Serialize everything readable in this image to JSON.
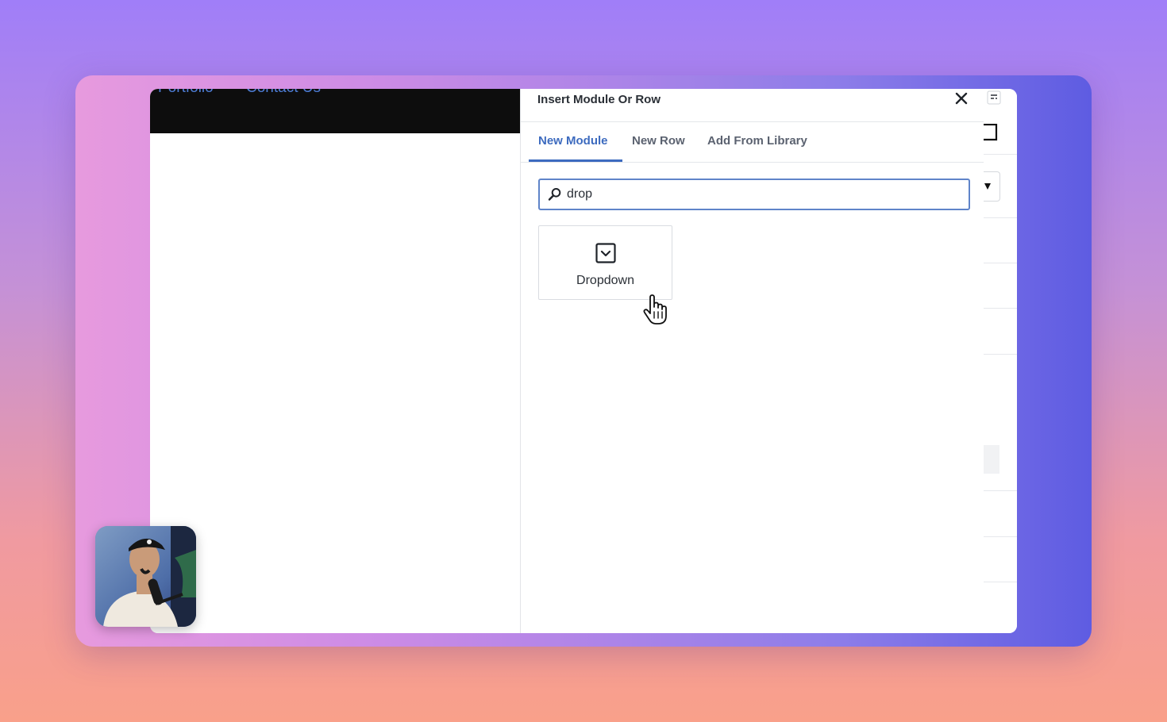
{
  "site": {
    "nav": [
      "Portfolio",
      "Contact Us"
    ]
  },
  "panel": {
    "title": "Insert Module Or Row",
    "close_icon": "close-icon",
    "tabs": [
      {
        "label": "New Module",
        "active": true
      },
      {
        "label": "New Row",
        "active": false
      },
      {
        "label": "Add From Library",
        "active": false
      }
    ],
    "search": {
      "value": "drop",
      "icon": "search-icon"
    },
    "results": [
      {
        "label": "Dropdown",
        "icon": "dropdown-icon"
      }
    ]
  },
  "colors": {
    "accent": "#3d6bbf",
    "search_border": "#5f84c9",
    "header_bg": "#0d0d0d",
    "nav_link": "#4d7dd6"
  }
}
